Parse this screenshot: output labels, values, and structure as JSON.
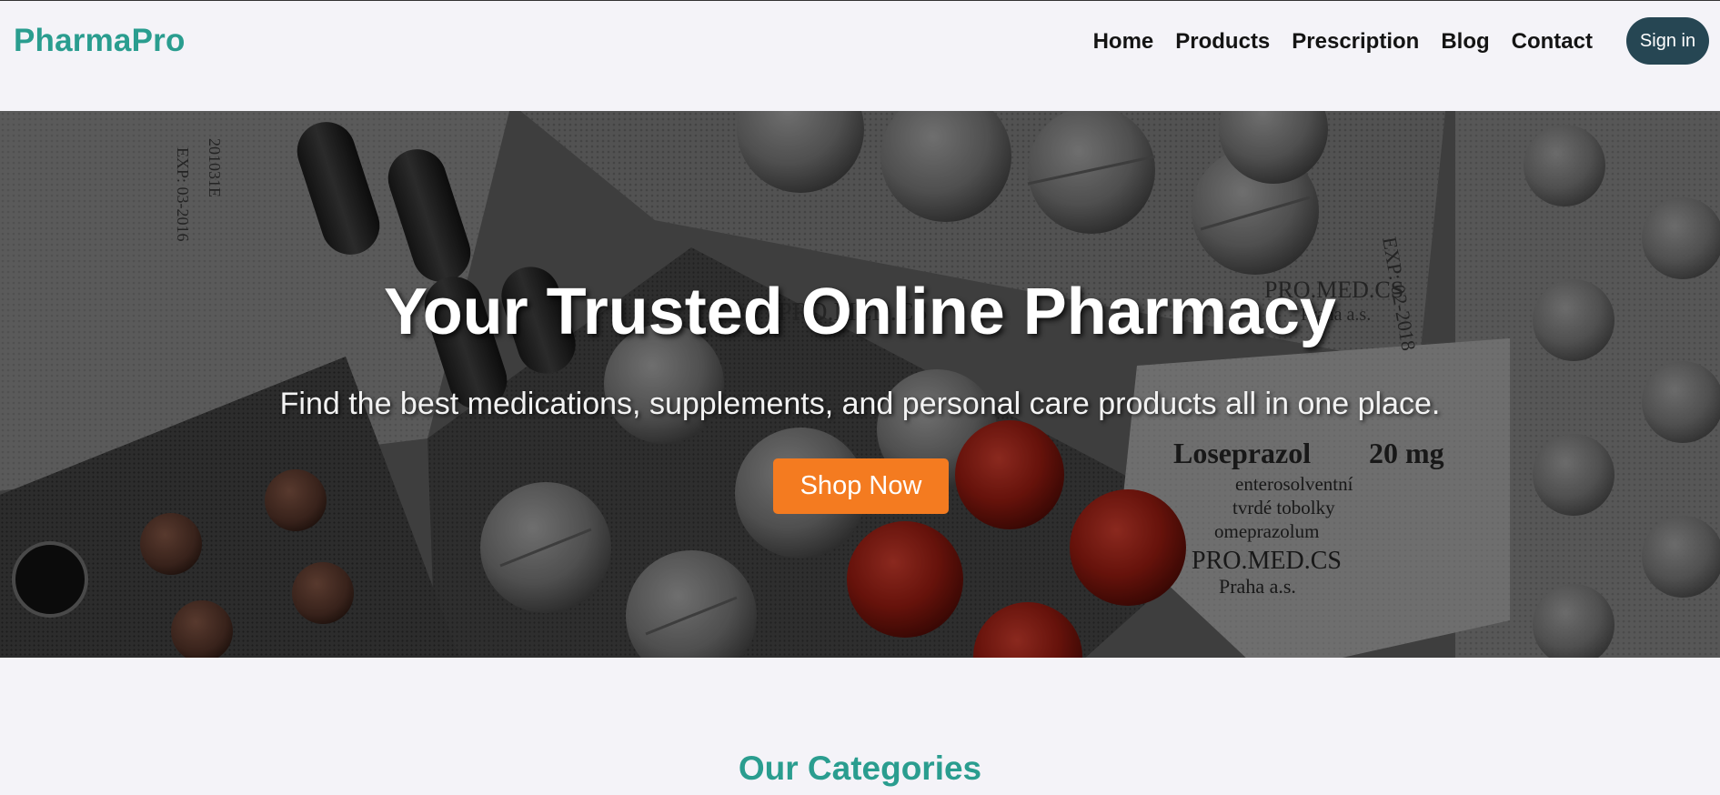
{
  "brand": {
    "name": "PharmaPro",
    "color": "#2a9d8f"
  },
  "nav": {
    "items": [
      {
        "label": "Home"
      },
      {
        "label": "Products"
      },
      {
        "label": "Prescription"
      },
      {
        "label": "Blog"
      },
      {
        "label": "Contact"
      }
    ],
    "signin_label": "Sign in",
    "signin_color": "#264653"
  },
  "hero": {
    "title": "Your Trusted Online Pharmacy",
    "subtitle": "Find the best medications, supplements, and personal care products all in one place.",
    "cta_label": "Shop Now",
    "cta_color": "#f47b20",
    "background_image": "pill-blister-packs-photo",
    "visible_pack_text": {
      "brand": "Loseprazol",
      "strength": "20 mg",
      "line1": "enterosolventní",
      "line2": "tvrdé tobolky",
      "line3": "omeprazolum",
      "maker": "PRO.MED.CS",
      "city": "Praha a.s.",
      "expiry": "EXP: 02-2018",
      "lot": "201031E",
      "exp_short": "EXP: 03-2016"
    }
  },
  "categories": {
    "title": "Our Categories"
  },
  "colors": {
    "page_background": "#f4f3f8",
    "nav_text": "#141414"
  }
}
